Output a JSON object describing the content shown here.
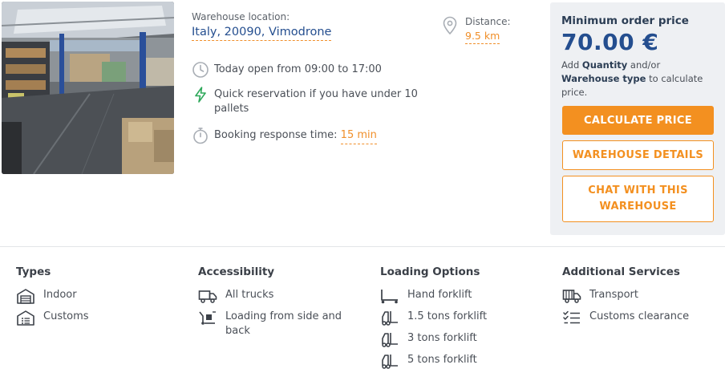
{
  "location": {
    "label": "Warehouse location:",
    "value": "Italy, 20090, Vimodrone"
  },
  "distance": {
    "label": "Distance:",
    "value": "9.5 km",
    "icon": "pin-icon"
  },
  "details": {
    "hours": "Today open from 09:00 to 17:00",
    "reservation": "Quick reservation if you have under 10 pallets",
    "response_label": "Booking response time:",
    "response_value": "15 min"
  },
  "price": {
    "title": "Minimum order price",
    "value": "70.00 €",
    "note_prefix": "Add ",
    "note_quantity": "Quantity",
    "note_mid": " and/or ",
    "note_type": "Warehouse type",
    "note_suffix": " to calculate price.",
    "calculate_button": "CALCULATE PRICE",
    "details_button": "WAREHOUSE DETAILS",
    "chat_button": "CHAT WITH THIS WAREHOUSE"
  },
  "features": {
    "types": {
      "title": "Types",
      "items": [
        "Indoor",
        "Customs"
      ]
    },
    "accessibility": {
      "title": "Accessibility",
      "items": [
        "All trucks",
        "Loading from side and back"
      ]
    },
    "loading": {
      "title": "Loading Options",
      "items": [
        "Hand forklift",
        "1.5 tons forklift",
        "3 tons forklift",
        "5 tons forklift"
      ]
    },
    "services": {
      "title": "Additional Services",
      "items": [
        "Transport",
        "Customs clearance"
      ]
    }
  },
  "colors": {
    "accent": "#f39020",
    "brand_blue": "#244e8f",
    "panel": "#eef0f3",
    "text": "#4a4f57"
  }
}
